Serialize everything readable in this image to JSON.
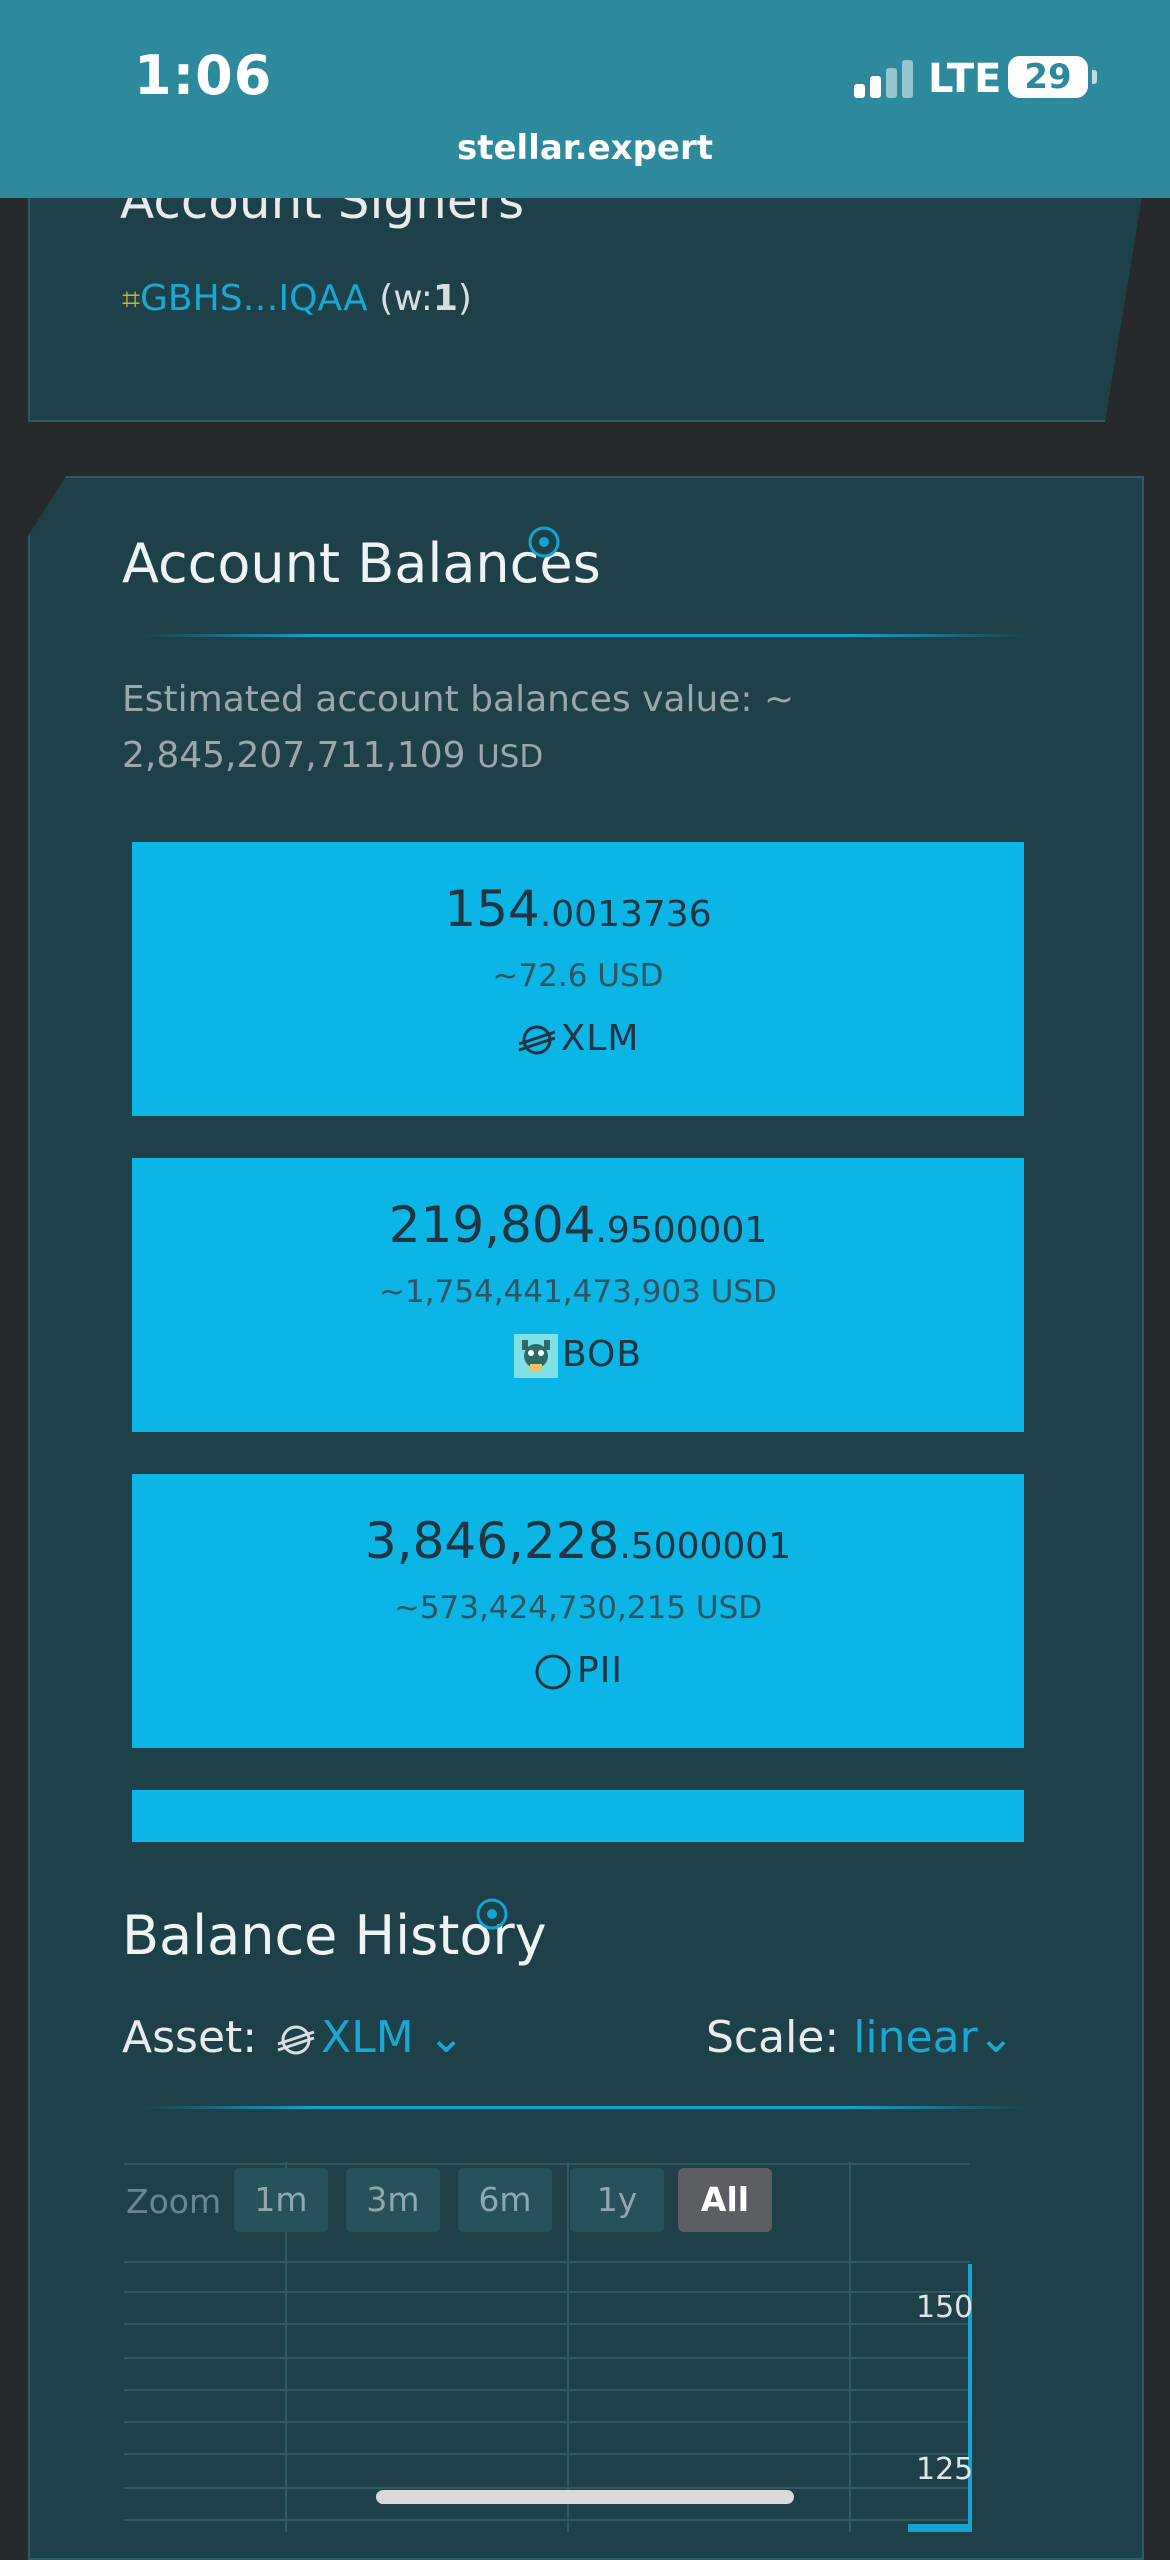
{
  "status_bar": {
    "time": "1:06",
    "network": "LTE",
    "battery": "29"
  },
  "browser": {
    "url": "stellar.expert"
  },
  "signers": {
    "title": "Account Signers",
    "signer_key": "GBHS…IQAA",
    "weight_prefix": " (w:",
    "weight": "1",
    "weight_suffix": ")"
  },
  "balances": {
    "title": "Account Balances",
    "estimate_label": "Estimated account balances value: ~",
    "estimate_value": "2,845,207,711,109",
    "estimate_unit": "USD",
    "cards": [
      {
        "amount_int": "154",
        "amount_frac": ".0013736",
        "usd": "~72.6 USD",
        "asset": "XLM",
        "icon": "stellar-icon"
      },
      {
        "amount_int": "219,804",
        "amount_frac": ".9500001",
        "usd": "~1,754,441,473,903 USD",
        "asset": "BOB",
        "icon": "bob-token-icon"
      },
      {
        "amount_int": "3,846,228",
        "amount_frac": ".5000001",
        "usd": "~573,424,730,215 USD",
        "asset": "PII",
        "icon": "circle-icon"
      }
    ]
  },
  "history": {
    "title": "Balance History",
    "asset_label": "Asset:",
    "asset_value": "XLM",
    "scale_label": "Scale:",
    "scale_value": "linear",
    "zoom_label": "Zoom",
    "zoom_options": [
      "1m",
      "3m",
      "6m",
      "1y",
      "All"
    ],
    "zoom_active": "All",
    "y_ticks": [
      "150",
      "125"
    ]
  },
  "colors": {
    "accent": "#0bb5e5",
    "link": "#1aa7d2",
    "topbar": "#2d8a9c",
    "panel": "#1d4049"
  }
}
